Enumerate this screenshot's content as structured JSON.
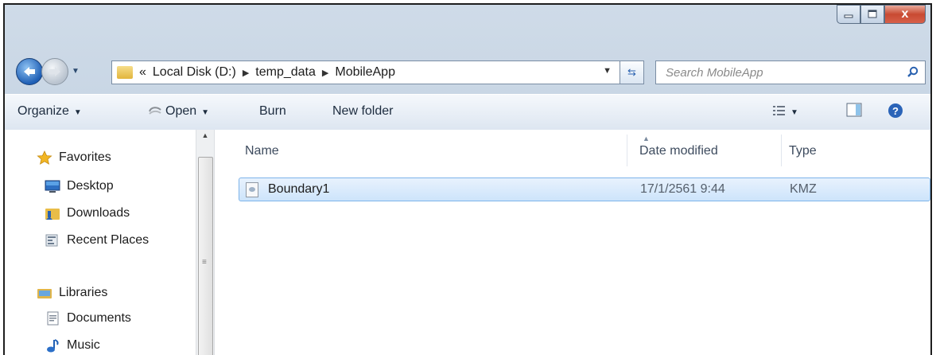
{
  "window": {
    "close_glyph": "x"
  },
  "address": {
    "chevrons": "«",
    "crumbs": [
      "Local Disk (D:)",
      "temp_data",
      "MobileApp"
    ],
    "search_placeholder": "Search MobileApp"
  },
  "toolbar": {
    "organize": "Organize",
    "open": "Open",
    "burn": "Burn",
    "new_folder": "New folder"
  },
  "nav": {
    "favorites": {
      "label": "Favorites",
      "items": [
        "Desktop",
        "Downloads",
        "Recent Places"
      ]
    },
    "libraries": {
      "label": "Libraries",
      "items": [
        "Documents",
        "Music"
      ]
    }
  },
  "columns": {
    "name": "Name",
    "date_modified": "Date modified",
    "type": "Type"
  },
  "files": [
    {
      "name": "Boundary1",
      "date": "17/1/2561 9:44",
      "type": "KMZ"
    }
  ],
  "colors": {
    "selection": "#cde4fb",
    "selection_border": "#7eb4ea",
    "close_button": "#c84a32"
  }
}
